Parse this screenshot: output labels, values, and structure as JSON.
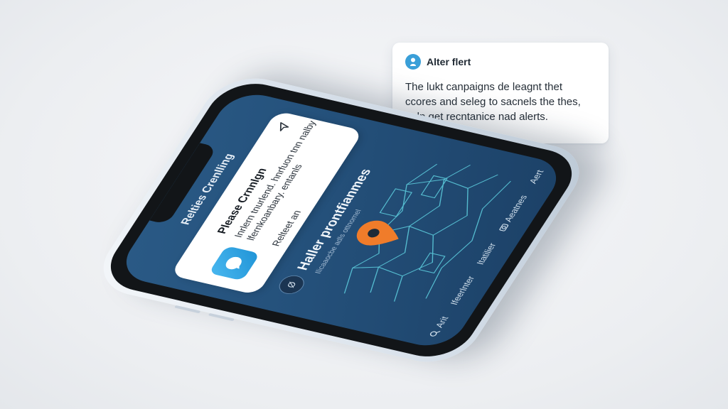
{
  "alert_card": {
    "title": "Alter flert",
    "body": "The lukt canpaigns de leagnt thet ccores and seleg to sacnels the thes, nalp get recntanice nad alerts.",
    "icon": "location-person-icon",
    "accent": "#3a9fd8"
  },
  "phone": {
    "screen_title": "Relties Crenlling",
    "notification": {
      "app_icon": "messenger-app-icon",
      "title": "Please Crnnlgn",
      "text": "Inrlern tnurlend. hnrfuon tnn nalby lfernkoanbary. entanls",
      "footer": "Relteet an",
      "send_icon": "send-arrow-icon"
    },
    "section": {
      "badge": "Ø",
      "title": "Haller prontfianmes",
      "subtitle": "Ilicaaocbe adls ottnomel"
    },
    "map": {
      "pin_color": "#f07c2a",
      "line_color": "#5fd0e0"
    },
    "bottom_bar": {
      "items": [
        {
          "icon": "search-icon",
          "label": "Arit"
        },
        {
          "icon": "",
          "label": "Ifeerlnter"
        },
        {
          "icon": "",
          "label": "Itatilier"
        },
        {
          "icon": "camera-icon",
          "label": "Aeatnes"
        },
        {
          "icon": "",
          "label": "Aert"
        }
      ]
    },
    "colors": {
      "screen": "#24507a",
      "bezel": "#121518",
      "frame": "#d7e0ea"
    }
  }
}
